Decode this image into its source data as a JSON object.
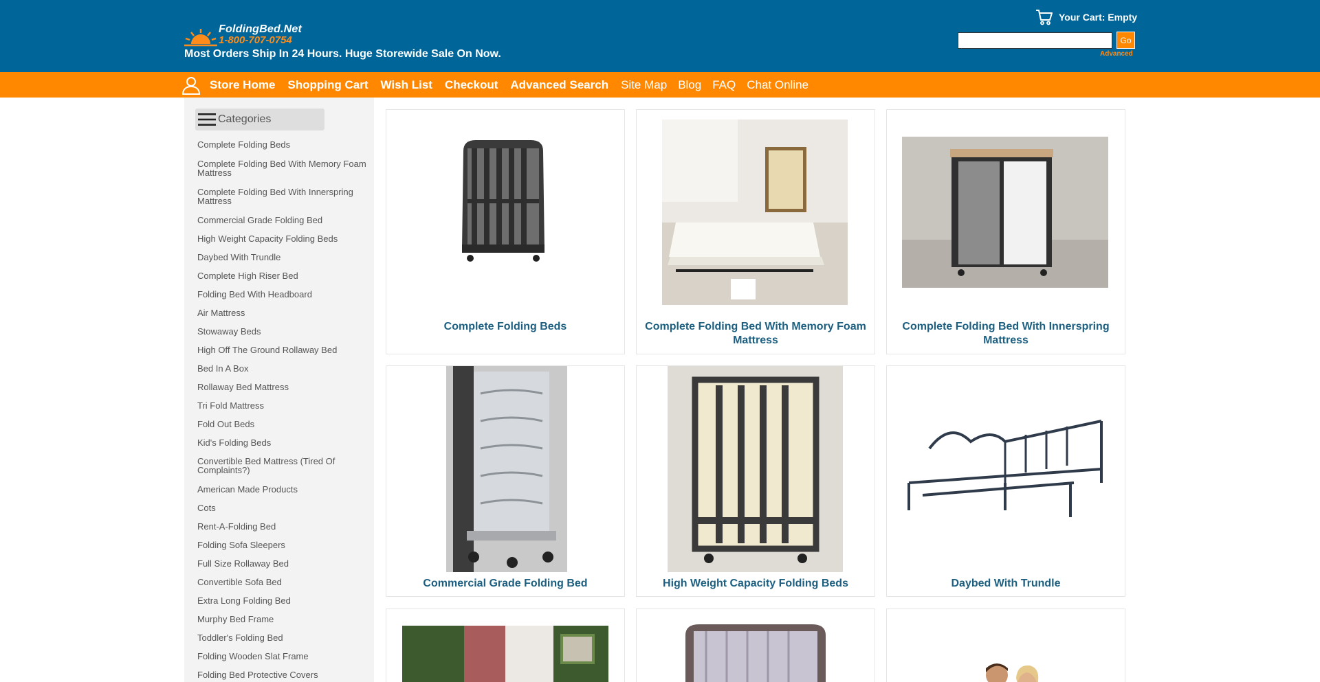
{
  "header": {
    "logo": {
      "name": "FoldingBed.Net",
      "phone": "1-800-707-0754"
    },
    "tagline": "Most Orders Ship In 24 Hours. Huge Storewide Sale On Now.",
    "cart_label": "Your Cart: Empty",
    "search": {
      "value": "",
      "go_label": "Go",
      "advanced_label": "Advanced"
    }
  },
  "nav": {
    "items": [
      {
        "label": "Store Home"
      },
      {
        "label": "Shopping Cart"
      },
      {
        "label": "Wish List"
      },
      {
        "label": "Checkout"
      },
      {
        "label": "Advanced Search"
      },
      {
        "label": "Site Map"
      },
      {
        "label": "Blog"
      },
      {
        "label": "FAQ"
      },
      {
        "label": "Chat Online"
      }
    ]
  },
  "sidebar": {
    "heading": "Categories",
    "items": [
      {
        "label": "Complete Folding Beds"
      },
      {
        "label": "Complete Folding Bed With Memory Foam Mattress"
      },
      {
        "label": "Complete Folding Bed With Innerspring Mattress"
      },
      {
        "label": "Commercial Grade Folding Bed"
      },
      {
        "label": "High Weight Capacity Folding Beds"
      },
      {
        "label": "Daybed With Trundle"
      },
      {
        "label": "Complete High Riser Bed"
      },
      {
        "label": "Folding Bed With Headboard"
      },
      {
        "label": "Air Mattress"
      },
      {
        "label": "Stowaway Beds"
      },
      {
        "label": "High Off The Ground Rollaway Bed"
      },
      {
        "label": "Bed In A Box"
      },
      {
        "label": "Rollaway Bed Mattress"
      },
      {
        "label": "Tri Fold Mattress"
      },
      {
        "label": "Fold Out Beds"
      },
      {
        "label": "Kid's Folding Beds"
      },
      {
        "label": "Convertible Bed Mattress (Tired Of Complaints?)"
      },
      {
        "label": "American Made Products"
      },
      {
        "label": "Cots"
      },
      {
        "label": "Rent-A-Folding Bed"
      },
      {
        "label": "Folding Sofa Sleepers"
      },
      {
        "label": "Full Size Rollaway Bed"
      },
      {
        "label": "Convertible Sofa Bed"
      },
      {
        "label": "Extra Long Folding Bed"
      },
      {
        "label": "Murphy Bed Frame"
      },
      {
        "label": "Toddler's Folding Bed"
      },
      {
        "label": "Folding Wooden Slat Frame"
      },
      {
        "label": "Folding Bed Protective Covers"
      }
    ]
  },
  "products": [
    {
      "title": "Complete Folding Beds"
    },
    {
      "title": "Complete Folding Bed With Memory Foam Mattress"
    },
    {
      "title": "Complete Folding Bed With Innerspring Mattress"
    },
    {
      "title": "Commercial Grade Folding Bed"
    },
    {
      "title": "High Weight Capacity Folding Beds"
    },
    {
      "title": "Daybed With Trundle"
    },
    {
      "title": ""
    },
    {
      "title": ""
    },
    {
      "title": ""
    }
  ],
  "colors": {
    "header_bg": "#006699",
    "nav_bg": "#ff8800",
    "accent_orange": "#ff8c1a",
    "product_title": "#1d5f80",
    "sidebar_bg": "#f3f3f3"
  },
  "icons": {
    "logo": "sunrise-logo-icon",
    "cart": "shopping-cart-icon",
    "user": "user-account-icon",
    "menu": "hamburger-menu-icon"
  }
}
